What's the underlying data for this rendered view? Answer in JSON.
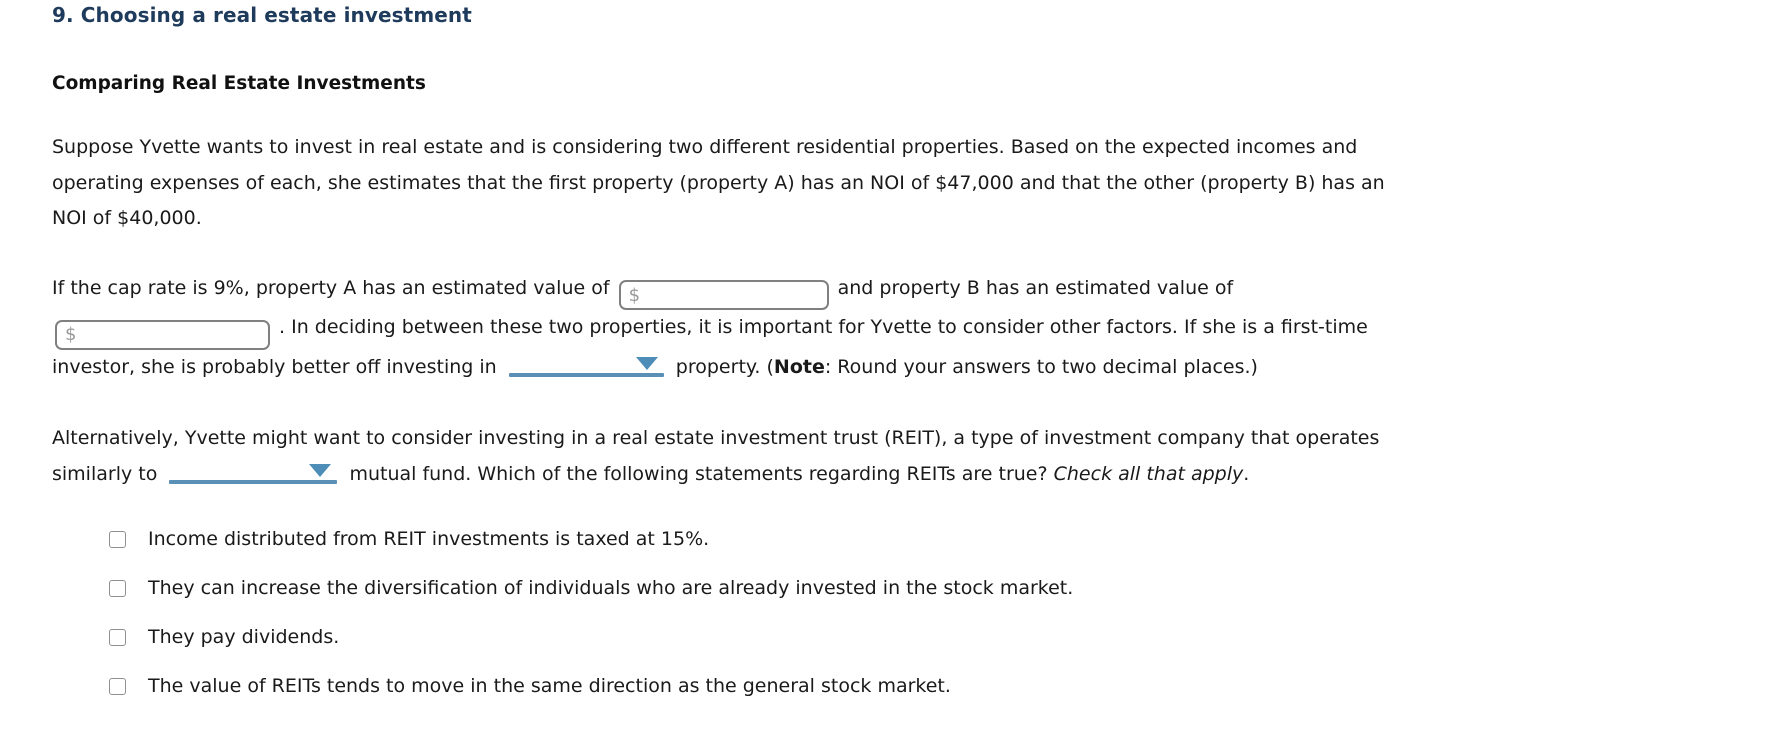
{
  "question": {
    "number_title": "9. Choosing a real estate investment",
    "section_heading": "Comparing Real Estate Investments"
  },
  "paragraph1": {
    "text": "Suppose Yvette wants to invest in real estate and is considering two different residential properties. Based on the expected incomes and operating expenses of each, she estimates that the first property (property A) has an NOI of $47,000 and that the other (property B) has an NOI of $40,000."
  },
  "paragraph2": {
    "seg1": "If the cap rate is 9%, property A has an estimated value of",
    "seg2": "and property B has an estimated value of",
    "seg3": ". In deciding between these two properties, it is important for Yvette to consider other factors. If she is a first-time investor, she is probably better off investing in",
    "seg4": "property. (",
    "note_bold": "Note",
    "seg5": ": Round your answers to two decimal places.)"
  },
  "paragraph3": {
    "seg1": "Alternatively, Yvette might want to consider investing in a real estate investment trust (REIT), a type of investment company that operates similarly to",
    "seg2": "mutual fund. Which of the following statements regarding REITs are true?",
    "italic": "Check all that apply",
    "seg3": "."
  },
  "inputs": {
    "property_a_value": {
      "name": "property-a-value",
      "value": "",
      "placeholder": "$"
    },
    "property_b_value": {
      "name": "property-b-value",
      "value": "",
      "placeholder": "$"
    }
  },
  "dropdowns": {
    "property_choice": {
      "name": "property-choice",
      "selected": ""
    },
    "fund_type": {
      "name": "fund-type",
      "selected": ""
    }
  },
  "checkboxes": [
    {
      "label": "Income distributed from REIT investments is taxed at 15%.",
      "checked": false
    },
    {
      "label": "They can increase the diversification of individuals who are already invested in the stock market.",
      "checked": false
    },
    {
      "label": "They pay dividends.",
      "checked": false
    },
    {
      "label": "The value of REITs tends to move in the same direction as the general stock market.",
      "checked": false
    }
  ],
  "colors": {
    "title_blue": "#1f3b5c",
    "dropdown_blue": "#5a90b5",
    "caret_blue": "#4d8db8",
    "input_border": "#808080",
    "checkbox_border": "#909090",
    "body_text": "#1a1a1a"
  }
}
